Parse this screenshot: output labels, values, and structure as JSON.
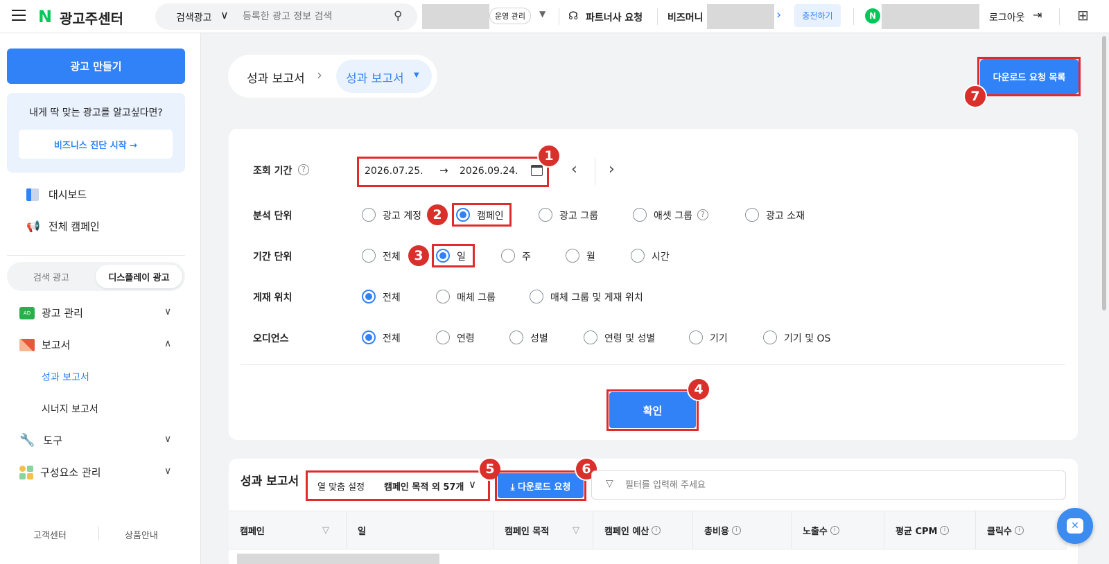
{
  "header": {
    "brand": "광고주센터",
    "search_type": "검색광고",
    "search_placeholder": "등록한 광고 정보 검색",
    "manage_label": "운영 관리",
    "partner_label": "파트너사 요청",
    "bizmoney_label": "비즈머니",
    "charge_label": "충전하기",
    "logout_label": "로그아웃"
  },
  "sidebar": {
    "create_ad": "광고 만들기",
    "promo_text": "내게 딱 맞는 광고를 알고싶다면?",
    "diagnosis_button": "비즈니스 진단 시작 →",
    "dashboard": "대시보드",
    "all_campaigns": "전체 캠페인",
    "tab_search": "검색 광고",
    "tab_display": "디스플레이 광고",
    "ad_manage": "광고 관리",
    "reports": "보고서",
    "performance_report": "성과 보고서",
    "synergy_report": "시너지 보고서",
    "tools": "도구",
    "component_manage": "구성요소 관리",
    "customer_center": "고객센터",
    "product_info": "상품안내"
  },
  "breadcrumb": {
    "root": "성과 보고서",
    "current": "성과 보고서"
  },
  "download_list_button": "다운로드 요청 목록",
  "filters": {
    "period_label": "조회 기간",
    "start_date": "2026.07.25.",
    "end_date": "2026.09.24.",
    "analysis_unit_label": "분석 단위",
    "analysis_options": [
      "광고 계정",
      "캠페인",
      "광고 그룹",
      "애셋 그룹",
      "광고 소재"
    ],
    "analysis_selected": "캠페인",
    "time_unit_label": "기간 단위",
    "time_options": [
      "전체",
      "일",
      "주",
      "월",
      "시간"
    ],
    "time_selected": "일",
    "placement_label": "게재 위치",
    "placement_options": [
      "전체",
      "매체 그룹",
      "매체 그룹 및 게재 위치"
    ],
    "placement_selected": "전체",
    "audience_label": "오디언스",
    "audience_options": [
      "전체",
      "연령",
      "성별",
      "연령 및 성별",
      "기기",
      "기기 및 OS"
    ],
    "audience_selected": "전체",
    "confirm": "확인"
  },
  "report": {
    "title": "성과 보고서",
    "column_setting_label": "열 맞춤 설정",
    "column_setting_value": "캠페인 목적 외 57개",
    "download_request": "⤓ 다운로드 요청",
    "filter_placeholder": "필터를 입력해 주세요",
    "columns": [
      "캠페인",
      "일",
      "캠페인 목적",
      "캠페인 예산",
      "총비용",
      "노출수",
      "평균 CPM",
      "클릭수"
    ]
  },
  "annotations": [
    "1",
    "2",
    "3",
    "4",
    "5",
    "6",
    "7"
  ],
  "colors": {
    "accent": "#3182f6",
    "highlight_red": "#e02b2b",
    "brand_green": "#03c75a"
  }
}
